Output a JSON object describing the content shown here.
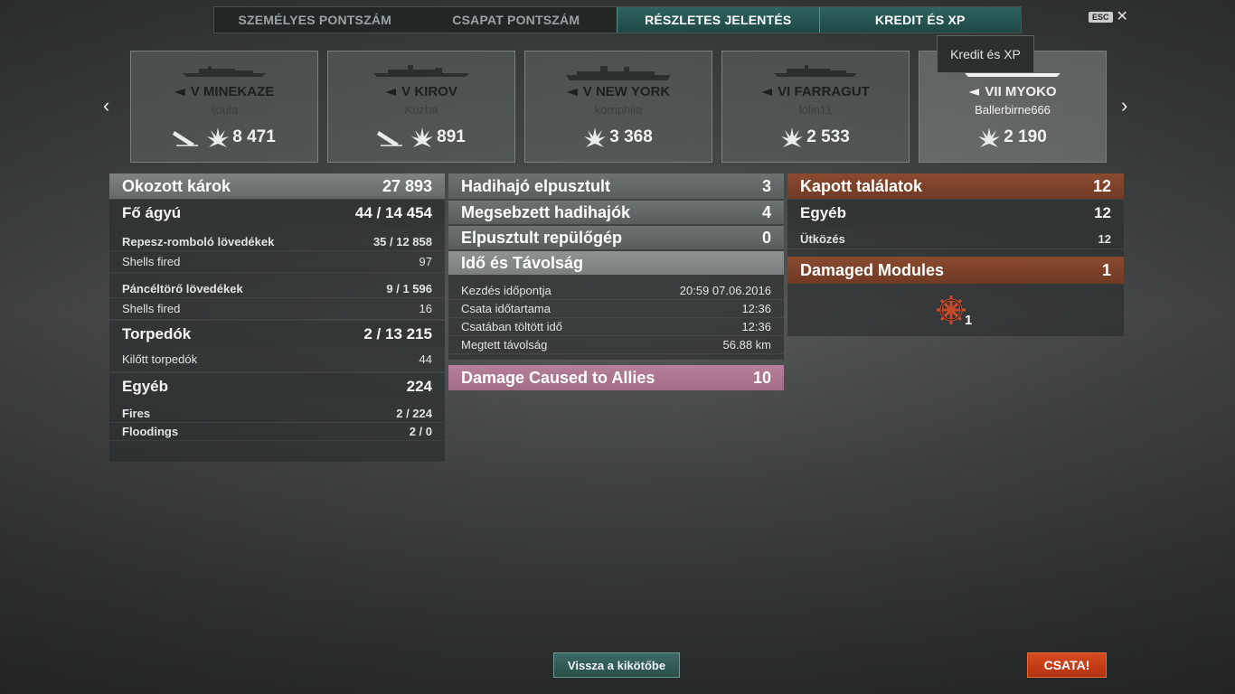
{
  "tabs": [
    "SZEMÉLYES PONTSZÁM",
    "CSAPAT PONTSZÁM",
    "RÉSZLETES JELENTÉS",
    "KREDIT ÉS XP"
  ],
  "esc_label": "ESC",
  "tooltip": "Kredit és XP",
  "ships": [
    {
      "name": "V MINEKAZE",
      "player": "ljoula",
      "damage": "8 471"
    },
    {
      "name": "V KIROV",
      "player": "Kuzba",
      "damage": "891"
    },
    {
      "name": "V NEW YORK",
      "player": "korriphila",
      "damage": "3 368"
    },
    {
      "name": "VI FARRAGUT",
      "player": "lolin11",
      "damage": "2 533"
    },
    {
      "name": "VII MYOKO",
      "player": "Ballerbirne666",
      "damage": "2 190"
    }
  ],
  "left": {
    "header": {
      "label": "Okozott károk",
      "value": "27 893"
    },
    "main_guns": {
      "label": "Fő ágyú",
      "value": "44 / 14 454"
    },
    "he": {
      "label": "Repesz-romboló lövedékek",
      "value": "35 / 12 858"
    },
    "he_fired": {
      "label": "Shells fired",
      "value": "97"
    },
    "ap": {
      "label": "Páncéltörő lövedékek",
      "value": "9 / 1 596"
    },
    "ap_fired": {
      "label": "Shells fired",
      "value": "16"
    },
    "torpedoes": {
      "label": "Torpedók",
      "value": "2 / 13 215"
    },
    "torp_fired": {
      "label": "Kilőtt torpedók",
      "value": "44"
    },
    "other": {
      "label": "Egyéb",
      "value": "224"
    },
    "fires": {
      "label": "Fires",
      "value": "2 / 224"
    },
    "floodings": {
      "label": "Floodings",
      "value": "2 / 0"
    }
  },
  "middle": {
    "destroyed": {
      "label": "Hadihajó elpusztult",
      "value": "3"
    },
    "damaged": {
      "label": "Megsebzett hadihajók",
      "value": "4"
    },
    "planes": {
      "label": "Elpusztult repülőgép",
      "value": "0"
    },
    "time_header": "Idő és Távolság",
    "start": {
      "label": "Kezdés időpontja",
      "value": "20:59  07.06.2016"
    },
    "duration": {
      "label": "Csata időtartama",
      "value": "12:36"
    },
    "in_battle": {
      "label": "Csatában töltött idő",
      "value": "12:36"
    },
    "distance": {
      "label": "Megtett távolság",
      "value": "56.88 km"
    },
    "allies": {
      "label": "Damage Caused to Allies",
      "value": "10"
    }
  },
  "right": {
    "hits": {
      "label": "Kapott találatok",
      "value": "12"
    },
    "other": {
      "label": "Egyéb",
      "value": "12"
    },
    "collision": {
      "label": "Ütközés",
      "value": "12"
    },
    "modules": {
      "label": "Damaged Modules",
      "value": "1"
    },
    "module_count": "1"
  },
  "buttons": {
    "back": "Vissza a kikötőbe",
    "battle": "CSATA!"
  },
  "colors": {
    "accent_teal": "#2f6460",
    "orange": "#8a4a30",
    "pink": "#b8809a",
    "battle": "#d64a1e"
  }
}
